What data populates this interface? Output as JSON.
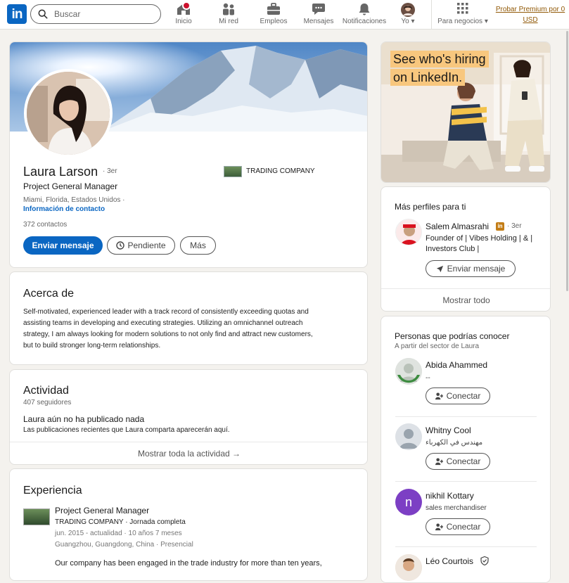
{
  "nav": {
    "logo": "in",
    "search_placeholder": "Buscar",
    "items": [
      {
        "label": "Inicio",
        "icon": "home-icon"
      },
      {
        "label": "Mi red",
        "icon": "network-icon"
      },
      {
        "label": "Empleos",
        "icon": "briefcase-icon"
      },
      {
        "label": "Mensajes",
        "icon": "chat-icon"
      },
      {
        "label": "Notificaciones",
        "icon": "bell-icon"
      },
      {
        "label": "Yo",
        "icon": "me-avatar"
      }
    ],
    "business": "Para negocios",
    "premium": "Probar Premium por 0 USD"
  },
  "profile": {
    "name": "Laura Larson",
    "degree": "· 3er",
    "headline": "Project General Manager",
    "company": "TRADING COMPANY",
    "location": "Miami, Florida, Estados Unidos ·",
    "contact_info": "Información de contacto",
    "connections": "372 contactos",
    "buttons": {
      "message": "Enviar mensaje",
      "pending": "Pendiente",
      "more": "Más"
    }
  },
  "about": {
    "title": "Acerca de",
    "lines": [
      "Self-motivated, experienced leader with a track record of consistently exceeding quotas and",
      "assisting teams in developing and executing strategies. Utilizing an omnichannel outreach",
      "strategy, I am always looking for modern solutions to not only find and attract new customers,",
      "but to build stronger long-term relationships."
    ]
  },
  "activity": {
    "title": "Actividad",
    "followers": "407 seguidores",
    "empty_title": "Laura aún no ha publicado nada",
    "empty_sub": "Las publicaciones recientes que Laura comparta aparecerán aquí.",
    "show_all": "Mostrar toda la actividad →"
  },
  "experience": {
    "title": "Experiencia",
    "role": "Project General Manager",
    "company_line": "TRADING COMPANY · Jornada completa",
    "dates": "jun. 2015 - actualidad · 10 años 7 meses",
    "location": "Guangzhou, Guangdong, China · Presencial",
    "description": "Our company has been engaged in the trade industry for more than ten years,"
  },
  "ad": {
    "line1": "See who's hiring",
    "line2": "on LinkedIn."
  },
  "more_profiles": {
    "title": "Más perfiles para ti",
    "person": {
      "name": "Salem Almasrahi",
      "degree": "· 3er",
      "sub": [
        "Founder of | Vibes Holding | & |",
        "Investors Club |"
      ],
      "button": "Enviar mensaje"
    },
    "show_all": "Mostrar todo"
  },
  "pymk": {
    "title": "Personas que podrías conocer",
    "subtitle": "A partir del sector de Laura",
    "people": [
      {
        "name": "Abida Ahammed",
        "sub": "--",
        "button": "Conectar"
      },
      {
        "name": "Whitny Cool",
        "sub": "مهندس في الكهرباء",
        "button": "Conectar"
      },
      {
        "name": "nikhil Kottary",
        "sub": "sales merchandiser",
        "button": "Conectar",
        "initial": "n"
      },
      {
        "name": "Léo Courtois"
      }
    ]
  },
  "colors": {
    "primary": "#0a66c2",
    "premium": "#915907",
    "bg": "#f4f2ee",
    "notify": "#cb112d"
  }
}
